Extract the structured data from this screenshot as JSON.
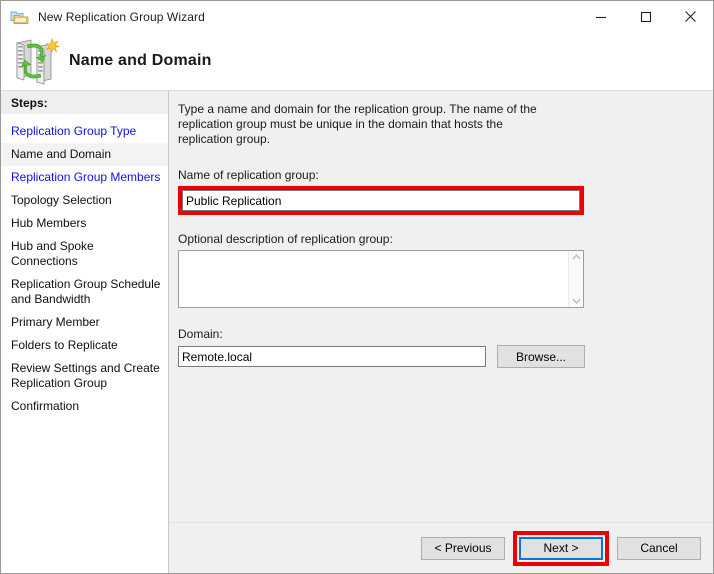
{
  "window": {
    "title": "New Replication Group Wizard",
    "icon": "folder-replication-icon",
    "controls": {
      "minimize": "minimize-icon",
      "maximize": "maximize-icon",
      "close": "close-icon"
    }
  },
  "banner": {
    "heading": "Name and Domain",
    "icon": "server-replication-icon"
  },
  "sidebar": {
    "header": "Steps:",
    "items": [
      {
        "label": "Replication Group Type",
        "state": "link"
      },
      {
        "label": "Name and Domain",
        "state": "current"
      },
      {
        "label": "Replication Group Members",
        "state": "link"
      },
      {
        "label": "Topology Selection",
        "state": "pending"
      },
      {
        "label": "Hub Members",
        "state": "pending"
      },
      {
        "label": "Hub and Spoke Connections",
        "state": "pending"
      },
      {
        "label": "Replication Group Schedule and Bandwidth",
        "state": "pending"
      },
      {
        "label": "Primary Member",
        "state": "pending"
      },
      {
        "label": "Folders to Replicate",
        "state": "pending"
      },
      {
        "label": "Review Settings and Create Replication Group",
        "state": "pending"
      },
      {
        "label": "Confirmation",
        "state": "pending"
      }
    ]
  },
  "main": {
    "intro": "Type a name and domain for the replication group. The name of the replication group must be unique in the domain that hosts the replication group.",
    "name_label": "Name of replication group:",
    "name_value": "Public Replication",
    "name_placeholder": "",
    "description_label": "Optional description of replication group:",
    "description_value": "",
    "description_placeholder": "",
    "domain_label": "Domain:",
    "domain_value": "Remote.local",
    "domain_placeholder": "",
    "browse_label": "Browse..."
  },
  "footer": {
    "previous_label": "< Previous",
    "next_label": "Next >",
    "cancel_label": "Cancel"
  },
  "annotations": {
    "color": "#ee0000",
    "targets": [
      "name-input",
      "next-button"
    ]
  },
  "colors": {
    "link": "#1111dd",
    "focus_border": "#0078d7",
    "content_bg": "#f0f0f0",
    "sidebar_bg": "#ffffff"
  }
}
